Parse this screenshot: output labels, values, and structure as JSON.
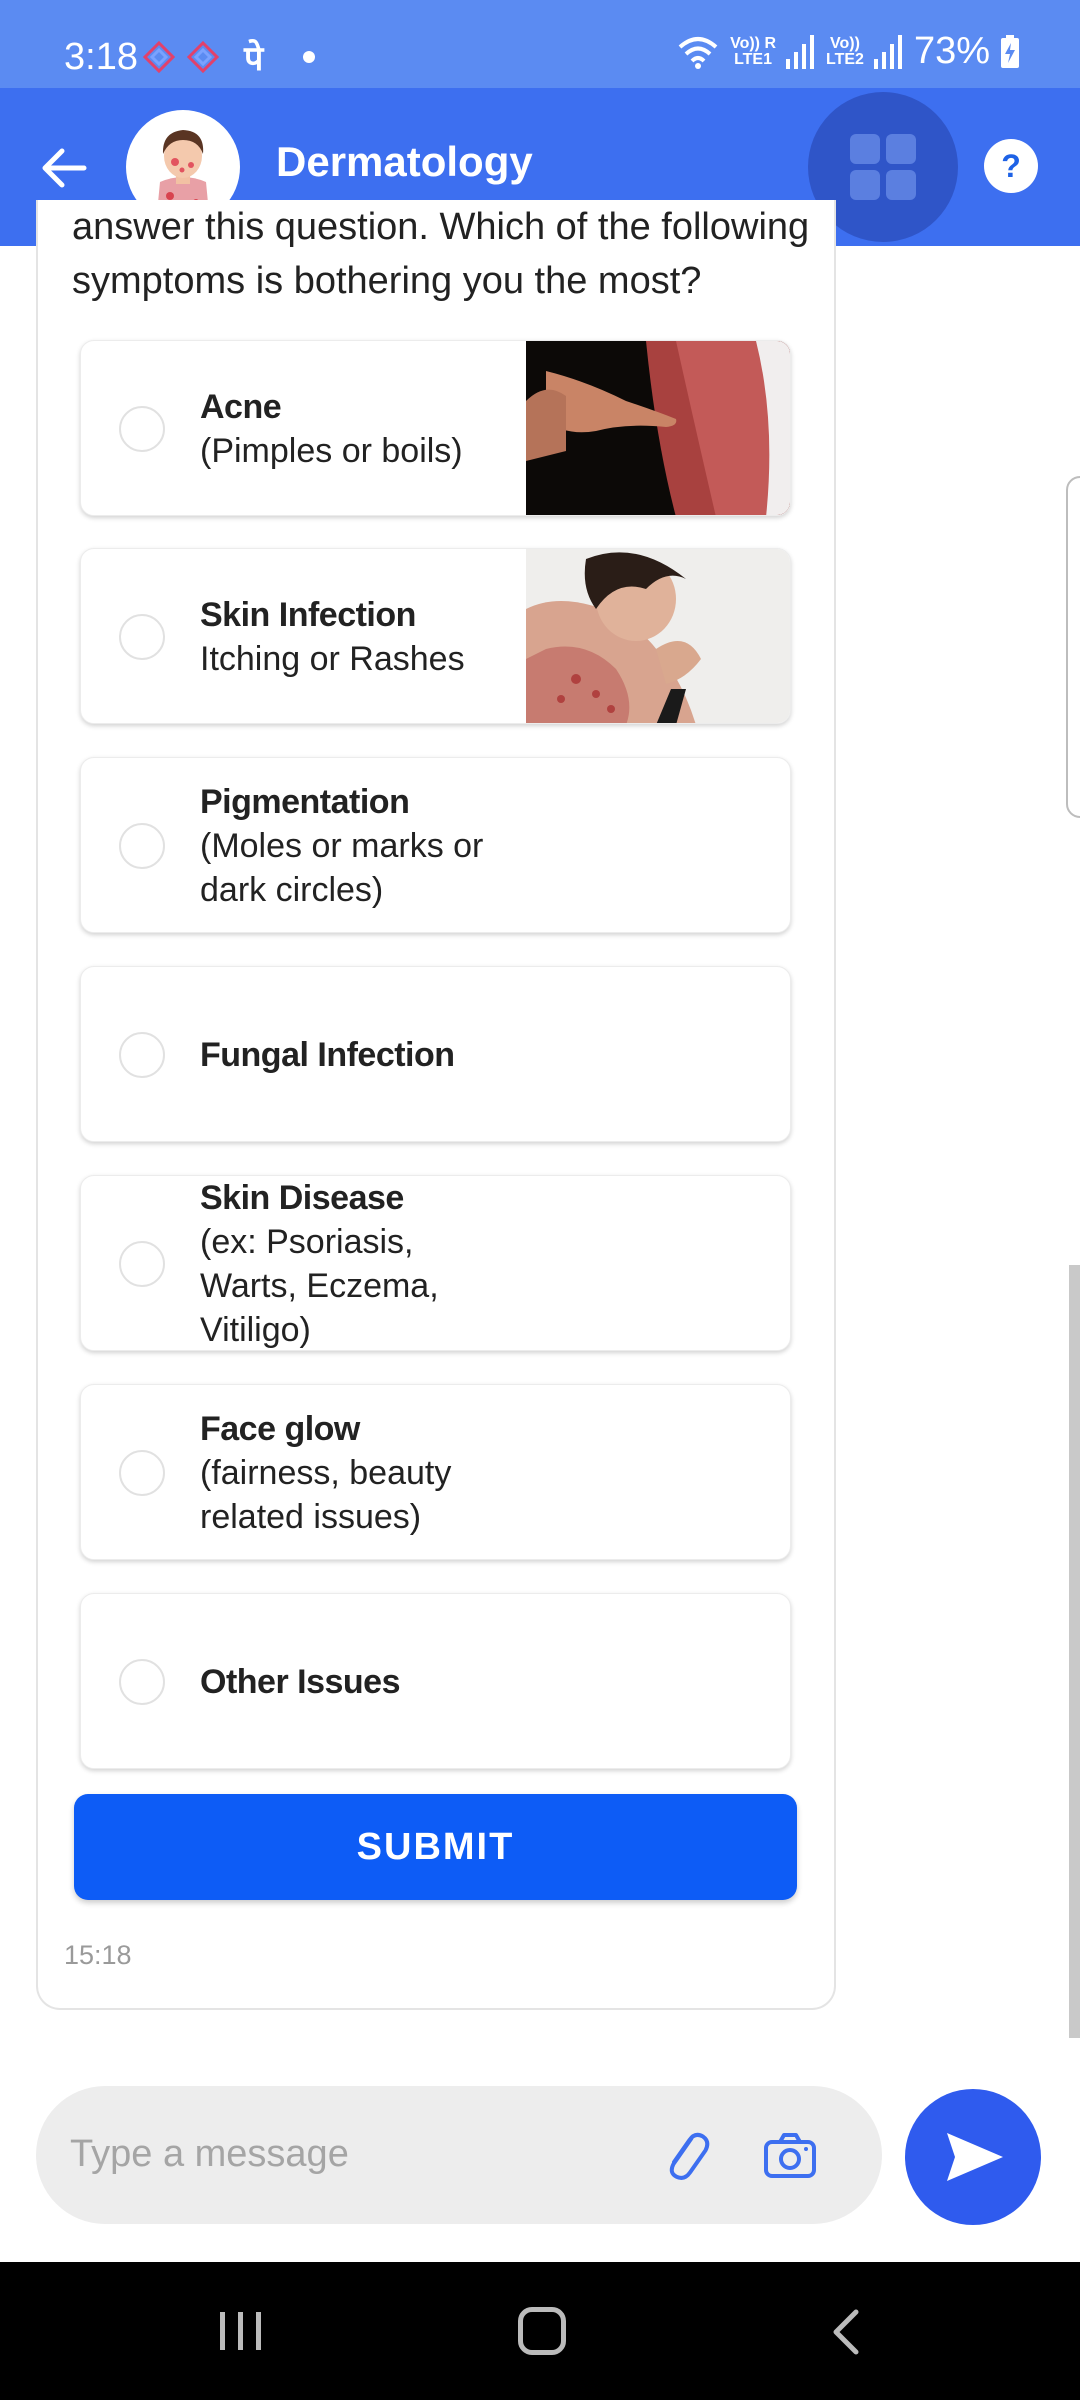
{
  "status_bar": {
    "time": "3:18",
    "pay_glyph": "पे",
    "net1": "Vo)) R\nLTE1",
    "net2": "Vo))\nLTE2",
    "battery": "73%"
  },
  "header": {
    "title": "Dermatology",
    "help_label": "?"
  },
  "chat": {
    "question": "answer this question. Which of the following symptoms is bothering you the most?",
    "options": [
      {
        "title": "Acne",
        "subtitle": "(Pimples or boils)",
        "has_image": true,
        "selected": false
      },
      {
        "title": "Skin Infection",
        "subtitle": "Itching or Rashes",
        "has_image": true,
        "selected": false
      },
      {
        "title": "Pigmentation",
        "subtitle": "(Moles or marks or dark circles)",
        "has_image": false,
        "selected": false
      },
      {
        "title": "Fungal Infection",
        "subtitle": "",
        "has_image": false,
        "selected": false
      },
      {
        "title": "Skin Disease",
        "subtitle": "(ex: Psoriasis, Warts, Eczema, Vitiligo)",
        "has_image": false,
        "selected": false
      },
      {
        "title": "Face glow",
        "subtitle": "(fairness, beauty related issues)",
        "has_image": false,
        "selected": false
      },
      {
        "title": "Other Issues",
        "subtitle": "",
        "has_image": false,
        "selected": false
      }
    ],
    "submit_label": "SUBMIT",
    "timestamp": "15:18"
  },
  "composer": {
    "placeholder": "Type a message"
  },
  "colors": {
    "status_bar": "#5b8bf2",
    "header": "#3d6ff0",
    "submit": "#0d5cf6",
    "send": "#2f5bee"
  },
  "icons": {
    "back": "arrow-left-icon",
    "apps": "grid-icon",
    "help": "help-icon",
    "attach": "paperclip-icon",
    "camera": "camera-icon",
    "send": "send-icon"
  }
}
